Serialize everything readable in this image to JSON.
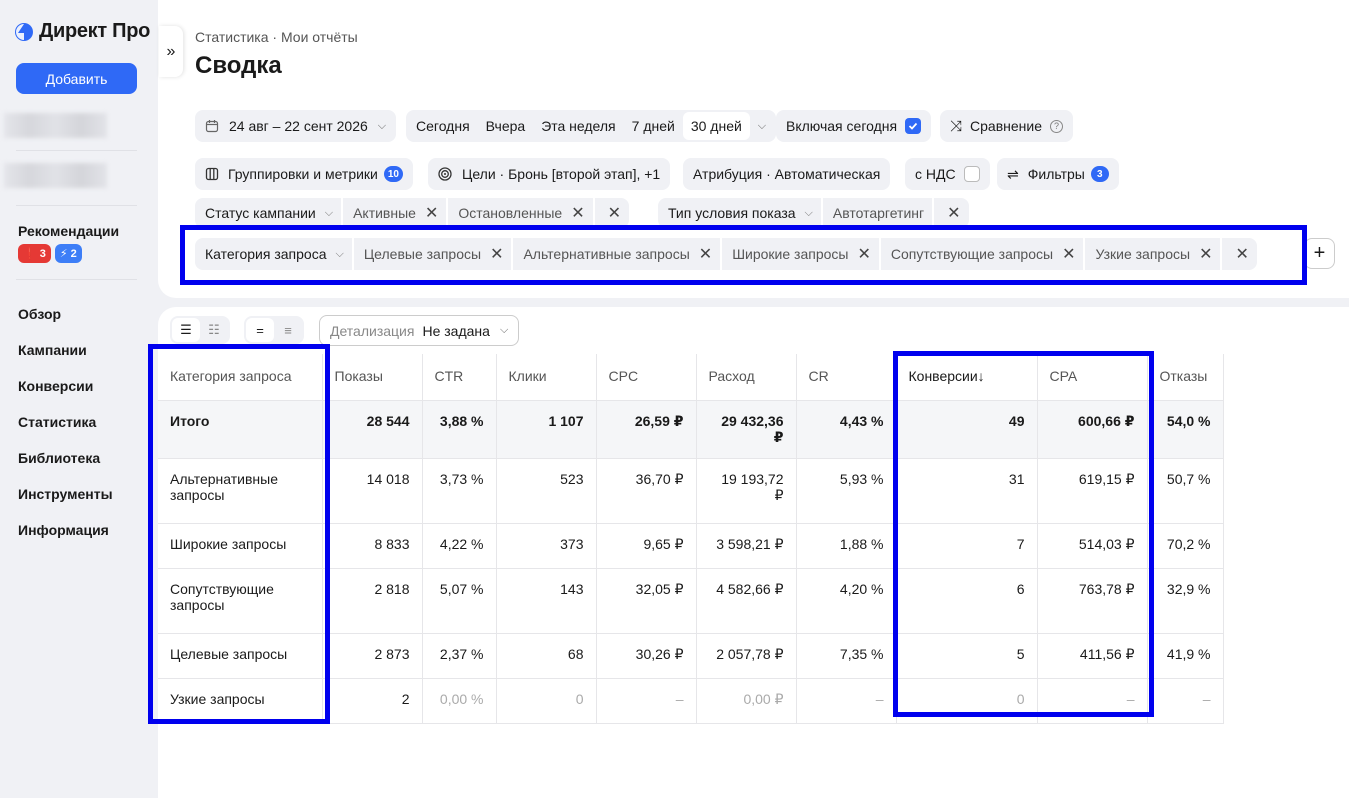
{
  "sidebar": {
    "logo": "Директ Про",
    "add_button": "Добавить",
    "recommendations": "Рекомендации",
    "badge_red": "3",
    "badge_blue": "2",
    "nav": [
      "Обзор",
      "Кампании",
      "Конверсии",
      "Статистика",
      "Библиотека",
      "Инструменты",
      "Информация"
    ]
  },
  "header": {
    "breadcrumb": "Статистика · Мои отчёты",
    "title": "Сводка"
  },
  "filters": {
    "date_range": "24 авг – 22 сент 2026",
    "periods": [
      "Сегодня",
      "Вчера",
      "Эта неделя",
      "7 дней",
      "30 дней"
    ],
    "include_today": "Включая сегодня",
    "compare": "Сравнение",
    "groupings": "Группировки и метрики",
    "groupings_count": "10",
    "goals": "Цели · Бронь [второй этап], +1",
    "attribution": "Атрибуция · Автоматическая",
    "vat": "с НДС",
    "filters_label": "Фильтры",
    "filters_count": "3",
    "row1": {
      "head": "Статус кампании",
      "chips": [
        "Активные",
        "Остановленные"
      ]
    },
    "row1b": {
      "head": "Тип условия показа",
      "chips": [
        "Автотаргетинг"
      ]
    },
    "row2": {
      "head": "Категория запроса",
      "chips": [
        "Целевые запросы",
        "Альтернативные запросы",
        "Широкие запросы",
        "Сопутствующие запросы",
        "Узкие запросы"
      ]
    }
  },
  "toolbar": {
    "detail_label": "Детализация",
    "detail_value": "Не задана"
  },
  "table": {
    "columns": [
      "Категория запроса",
      "Показы",
      "CTR",
      "Клики",
      "CPC",
      "Расход",
      "CR",
      "Конверсии↓",
      "CPA",
      "Отказы"
    ],
    "total": [
      "Итого",
      "28 544",
      "3,88 %",
      "1 107",
      "26,59 ₽",
      "29 432,36 ₽",
      "4,43 %",
      "49",
      "600,66 ₽",
      "54,0 %"
    ],
    "rows": [
      [
        "Альтернативные запросы",
        "14 018",
        "3,73 %",
        "523",
        "36,70 ₽",
        "19 193,72 ₽",
        "5,93 %",
        "31",
        "619,15 ₽",
        "50,7 %"
      ],
      [
        "Широкие запросы",
        "8 833",
        "4,22 %",
        "373",
        "9,65 ₽",
        "3 598,21 ₽",
        "1,88 %",
        "7",
        "514,03 ₽",
        "70,2 %"
      ],
      [
        "Сопутствующие запросы",
        "2 818",
        "5,07 %",
        "143",
        "32,05 ₽",
        "4 582,66 ₽",
        "4,20 %",
        "6",
        "763,78 ₽",
        "32,9 %"
      ],
      [
        "Целевые запросы",
        "2 873",
        "2,37 %",
        "68",
        "30,26 ₽",
        "2 057,78 ₽",
        "7,35 %",
        "5",
        "411,56 ₽",
        "41,9 %"
      ],
      [
        "Узкие запросы",
        "2",
        "0,00 %",
        "0",
        "–",
        "0,00 ₽",
        "–",
        "0",
        "–",
        "–"
      ]
    ]
  }
}
